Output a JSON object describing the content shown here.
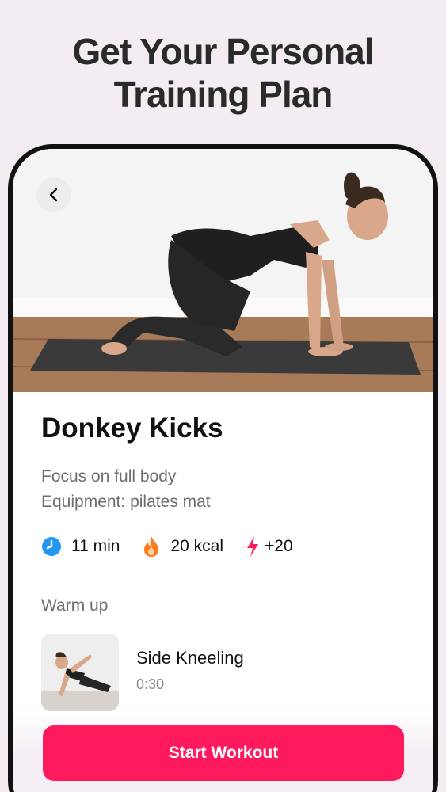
{
  "headline": {
    "line1": "Get Your Personal",
    "line2": "Training Plan"
  },
  "exercise": {
    "title": "Donkey Kicks",
    "focus": "Focus on full body",
    "equipment": "Equipment: pilates mat",
    "stats": {
      "duration": "11 min",
      "calories": "20 kcal",
      "points": "+20"
    }
  },
  "section": {
    "label": "Warm up"
  },
  "warmup_item": {
    "name": "Side Kneeling",
    "duration": "0:30"
  },
  "cta": {
    "label": "Start Workout"
  },
  "colors": {
    "accent": "#ff1a5e",
    "clock": "#2196f3",
    "flame": "#ff7a1a",
    "bolt": "#ff1a5e",
    "background": "#f3ecf3"
  },
  "icons": {
    "back": "chevron-left-icon",
    "duration": "clock-icon",
    "calories": "flame-icon",
    "points": "lightning-bolt-icon"
  }
}
